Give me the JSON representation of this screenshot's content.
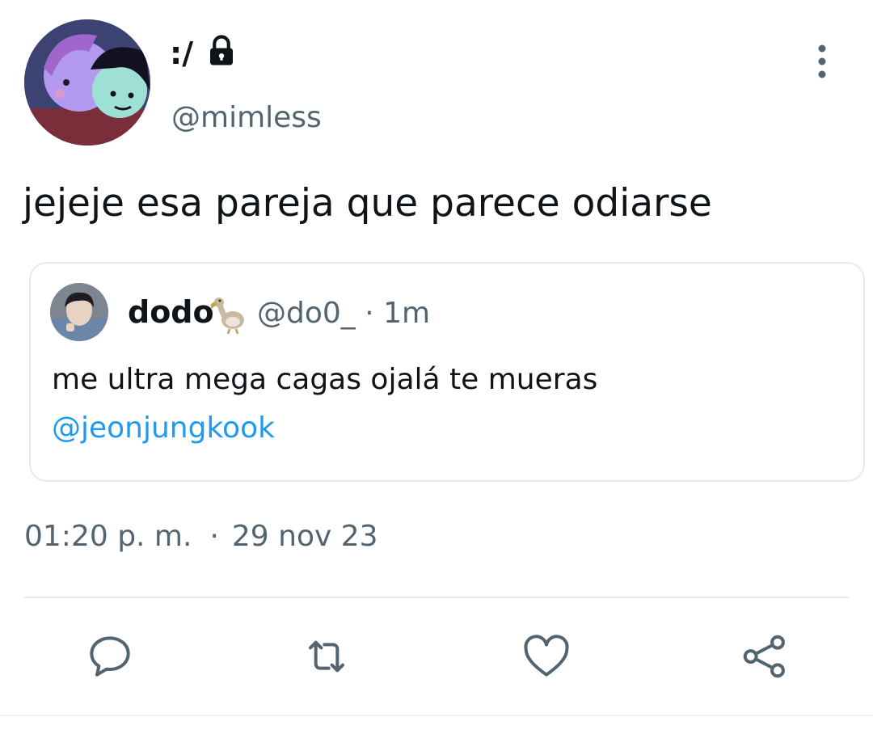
{
  "author": {
    "display_name": ":/",
    "handle": "@mimless",
    "protected_icon": "lock-icon",
    "avatar_icon": "avatar-illustration"
  },
  "tweet": {
    "text": "jejeje esa pareja que parece odiarse",
    "timestamp": "01:20 p. m.",
    "separator": "·",
    "date": "29 nov 23"
  },
  "quote": {
    "name": "dodo",
    "name_emoji_icon": "dodo-bird-icon",
    "handle_and_time": "@do0_ · 1m",
    "text": "me ultra mega cagas ojalá te mueras",
    "mention": "@jeonjungkook"
  },
  "actions": {
    "reply_icon": "reply-icon",
    "retweet_icon": "retweet-icon",
    "like_icon": "heart-icon",
    "share_icon": "share-icon",
    "more_icon": "more-vertical-icon"
  },
  "colors": {
    "text_primary": "#0f1419",
    "text_secondary": "#536471",
    "link": "#1d9bf0",
    "border": "#e6e9eb"
  }
}
